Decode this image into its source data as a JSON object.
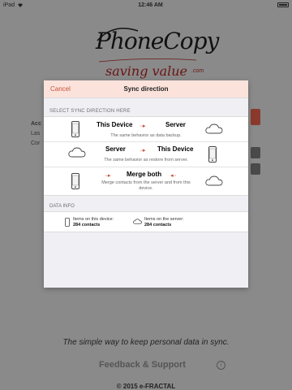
{
  "status_bar": {
    "carrier": "iPad",
    "time": "12:46 AM"
  },
  "background": {
    "logo_title": "PhoneCopy",
    "logo_subtitle": "saving value",
    "logo_domain": ".com",
    "account_lines": [
      "Acc",
      "Las",
      "Cor"
    ],
    "tagline": "The simple way to keep personal data in sync.",
    "feedback_label": "Feedback & Support",
    "copyright": "© 2015 e-FRACTAL",
    "accent": "#c8503a"
  },
  "modal": {
    "cancel_label": "Cancel",
    "title": "Sync direction",
    "section_label": "SELECT SYNC DIRECTION HERE",
    "options": [
      {
        "from": "This Device",
        "to": "Server",
        "arrow": "···▸",
        "description": "The same behavior as data backup."
      },
      {
        "from": "Server",
        "to": "This Device",
        "arrow": "···▸",
        "description": "The same behavior as restore from server."
      },
      {
        "title": "Merge both",
        "arrow_left": "···▸",
        "arrow_right": "◂···",
        "description_line1": "Merge contacts from the server and from this",
        "description_line2": "device."
      }
    ],
    "data_info_label": "DATA INFO",
    "device_items_label": "Items on this device:",
    "device_items_count": "284 contacts",
    "server_items_label": "Items on the server:",
    "server_items_count": "284 contacts"
  }
}
